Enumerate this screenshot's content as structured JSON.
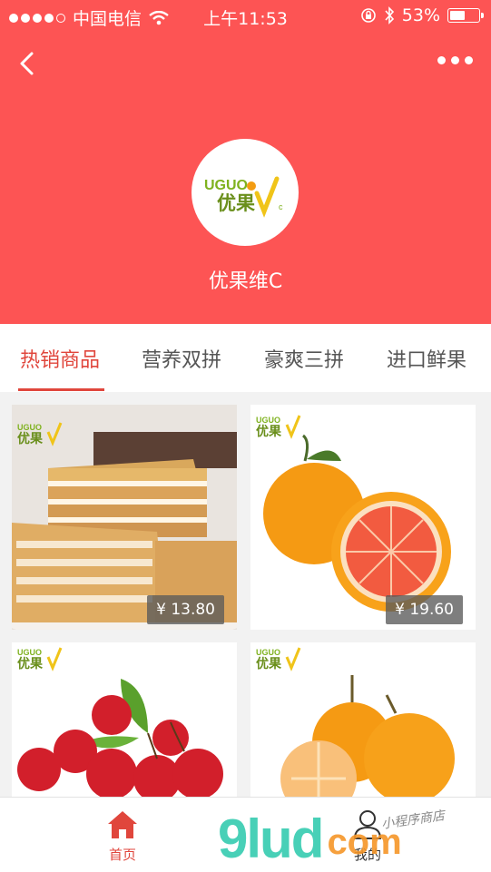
{
  "status_bar": {
    "carrier": "中国电信",
    "time": "上午11:53",
    "battery": "53%"
  },
  "shop": {
    "name": "优果维C",
    "logo_text": "UGUO",
    "logo_cn": "优果"
  },
  "tabs": [
    {
      "label": "热销商品",
      "active": true
    },
    {
      "label": "营养双拼",
      "active": false
    },
    {
      "label": "豪爽三拼",
      "active": false
    },
    {
      "label": "进口鲜果",
      "active": false
    }
  ],
  "products": [
    {
      "name": "cake",
      "price": "¥ 13.80"
    },
    {
      "name": "blood-orange",
      "price": "¥ 19.60"
    },
    {
      "name": "cherries",
      "price": ""
    },
    {
      "name": "tangerines",
      "price": ""
    }
  ],
  "tabbar": {
    "home_label": "首页",
    "mine_label": "我的"
  },
  "watermark": {
    "logo": "9lud",
    "domain": "com",
    "note": "小程序商店"
  },
  "colors": {
    "primary": "#fd5454",
    "active_text": "#e0463c"
  }
}
